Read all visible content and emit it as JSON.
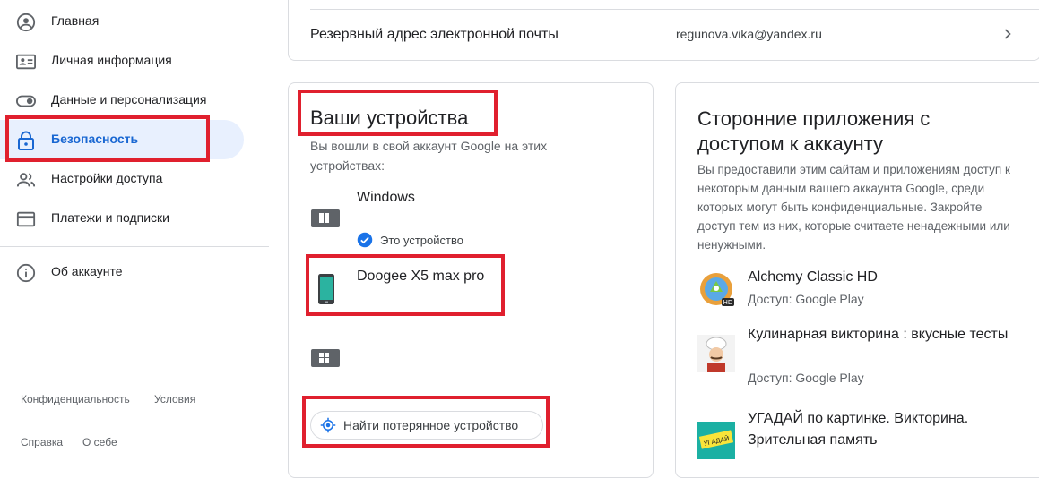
{
  "sidebar": {
    "items": [
      {
        "label": "Главная",
        "icon": "account-circle-icon"
      },
      {
        "label": "Личная информация",
        "icon": "id-card-icon"
      },
      {
        "label": "Данные и персонализация",
        "icon": "toggle-icon"
      },
      {
        "label": "Безопасность",
        "icon": "lock-icon",
        "active": true
      },
      {
        "label": "Настройки доступа",
        "icon": "people-icon"
      },
      {
        "label": "Платежи и подписки",
        "icon": "credit-card-icon"
      }
    ],
    "about": {
      "label": "Об аккаунте",
      "icon": "info-icon"
    },
    "footer": {
      "privacy": "Конфиденциальность",
      "terms": "Условия",
      "help": "Справка",
      "about_me": "О себе"
    }
  },
  "email_card": {
    "label": "Резервный адрес электронной почты",
    "value": "regunova.vika@yandex.ru"
  },
  "devices_card": {
    "title": "Ваши устройства",
    "description": "Вы вошли в свой аккаунт Google на этих устройствах:",
    "devices": [
      {
        "name": "Windows",
        "type": "laptop-icon",
        "this_device_label": "Это устройство"
      },
      {
        "name": "Doogee X5 max pro",
        "type": "phone-icon"
      },
      {
        "name": "",
        "type": "laptop-icon"
      }
    ],
    "find_button": "Найти потерянное устройство"
  },
  "apps_card": {
    "title": "Сторонние приложения с доступом к аккаунту",
    "description": "Вы предоставили этим сайтам и приложениям доступ к некоторым данным вашего аккаунта Google, среди которых могут быть конфиденциальные. Закройте доступ тем из них, которые считаете ненадежными или ненужными.",
    "apps": [
      {
        "name": "Alchemy Classic HD",
        "access": "Доступ: Google Play"
      },
      {
        "name": "Кулинарная викторина : вкусные тесты",
        "access": "Доступ: Google Play"
      },
      {
        "name": "УГАДАЙ по картинке. Викторина. Зрительная память",
        "access": "",
        "icon_text": "УГАДАЙ"
      }
    ]
  },
  "colors": {
    "accent": "#1a73e8",
    "active_bg": "#e8f0fe",
    "highlight": "#e0202e",
    "border": "#dadce0"
  }
}
